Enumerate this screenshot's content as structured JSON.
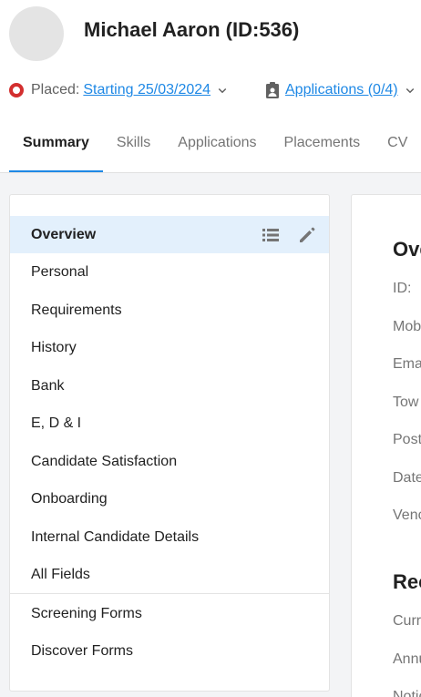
{
  "candidate": {
    "name": "Michael Aaron (ID:536)"
  },
  "status": {
    "label": "Placed:",
    "link_text": "Starting 25/03/2024",
    "color": "#d32f2f"
  },
  "applications": {
    "link_text": "Applications (0/4)"
  },
  "tabs": [
    {
      "label": "Summary",
      "active": true
    },
    {
      "label": "Skills"
    },
    {
      "label": "Applications"
    },
    {
      "label": "Placements"
    },
    {
      "label": "CV"
    }
  ],
  "nav": {
    "items": [
      {
        "label": "Overview",
        "active": true
      },
      {
        "label": "Personal"
      },
      {
        "label": "Requirements"
      },
      {
        "label": "History"
      },
      {
        "label": "Bank"
      },
      {
        "label": "E, D & I"
      },
      {
        "label": "Candidate Satisfaction"
      },
      {
        "label": "Onboarding"
      },
      {
        "label": "Internal Candidate Details"
      },
      {
        "label": "All Fields"
      }
    ],
    "forms": [
      {
        "label": "Screening Forms"
      },
      {
        "label": "Discover Forms"
      }
    ],
    "icons": [
      "list-icon",
      "pencil-icon"
    ]
  },
  "detail": {
    "overview_heading": "Ove",
    "overview_labels": [
      "ID:",
      "Mob",
      "Ema",
      "Tow",
      "Post",
      "Date",
      "Venc"
    ],
    "requirements_heading": "Rec",
    "requirements_labels": [
      "Curr",
      "Annu",
      "Notic"
    ]
  },
  "colors": {
    "accent": "#1e88e5",
    "active_bg": "#e3f0fc"
  }
}
